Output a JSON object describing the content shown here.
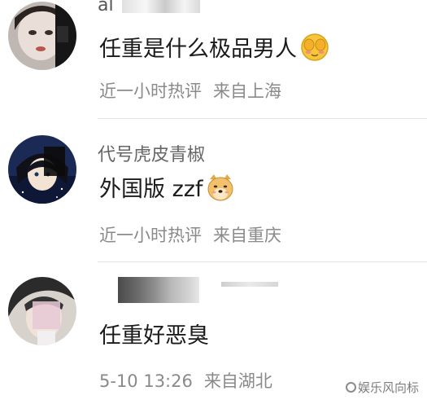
{
  "comments": [
    {
      "username": "al",
      "text": "任重是什么极品男人",
      "emoji": "shy-face-emoji",
      "time": "近一小时热评",
      "location": "来自上海"
    },
    {
      "username": "代号虎皮青椒",
      "text": "外国版 zzf",
      "emoji": "doge-emoji",
      "time": "近一小时热评",
      "location": "来自重庆"
    },
    {
      "username": "",
      "text": "任重好恶臭",
      "emoji": "",
      "time": "5-10 13:26",
      "location": "来自湖北"
    }
  ],
  "watermark": {
    "text": "娱乐风向标"
  }
}
